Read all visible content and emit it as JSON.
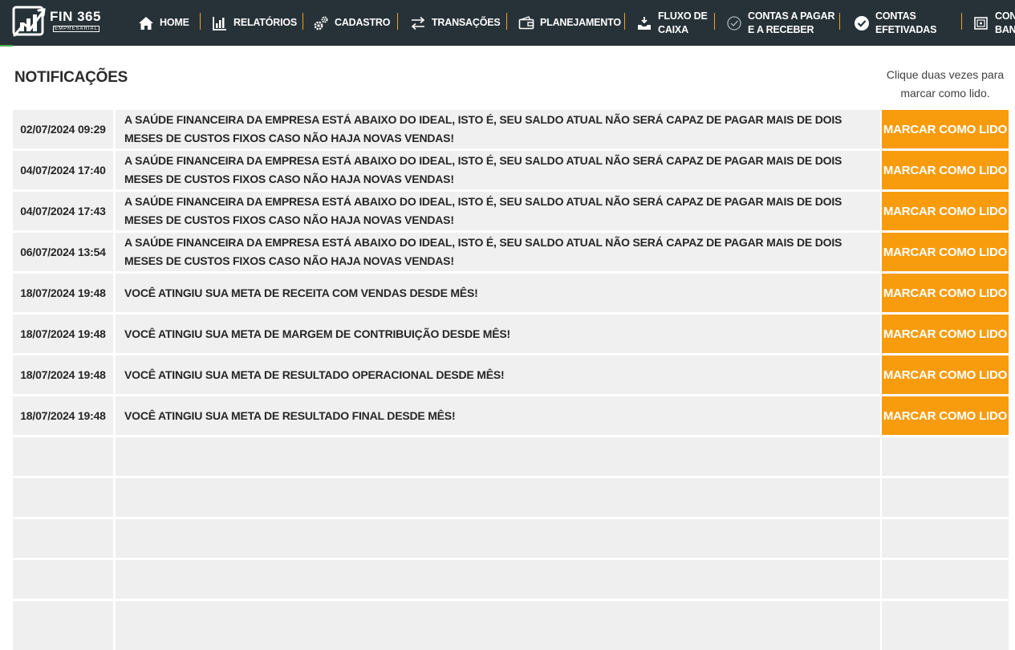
{
  "app": {
    "brand": "FIN 365",
    "brand_sub": "EMPRESARIAL"
  },
  "nav": [
    {
      "label": "HOME",
      "icon": "home-icon"
    },
    {
      "label": "RELATÓRIOS",
      "icon": "bar-chart-icon"
    },
    {
      "label": "CADASTRO",
      "icon": "gears-icon"
    },
    {
      "label": "TRANSAÇÕES",
      "icon": "transfer-arrows-icon"
    },
    {
      "label": "PLANEJAMENTO",
      "icon": "wallet-icon"
    },
    {
      "label": "FLUXO DE\nCAIXA",
      "icon": "money-hand-icon"
    },
    {
      "label": "CONTAS A PAGAR\nE A RECEBER",
      "icon": "check-circle-outline-icon"
    },
    {
      "label": "CONTAS\nEFETIVADAS",
      "icon": "check-circle-filled-icon"
    },
    {
      "label": "CONC\nBANC",
      "icon": "bank-icon"
    }
  ],
  "page": {
    "title": "NOTIFICAÇÕES",
    "hint": "Clique duas vezes para\nmarcar como lido."
  },
  "notifications": [
    {
      "date": "02/07/2024 09:29",
      "message": "A SAÚDE FINANCEIRA DA EMPRESA ESTÁ ABAIXO DO IDEAL, ISTO É, SEU SALDO ATUAL NÃO SERÁ CAPAZ DE PAGAR MAIS DE DOIS MESES DE CUSTOS FIXOS CASO NÃO HAJA NOVAS VENDAS!",
      "action": "MARCAR COMO LIDO"
    },
    {
      "date": "04/07/2024 17:40",
      "message": "A SAÚDE FINANCEIRA DA EMPRESA ESTÁ ABAIXO DO IDEAL, ISTO É, SEU SALDO ATUAL NÃO SERÁ CAPAZ DE PAGAR MAIS DE DOIS MESES DE CUSTOS FIXOS CASO NÃO HAJA NOVAS VENDAS!",
      "action": "MARCAR COMO LIDO"
    },
    {
      "date": "04/07/2024 17:43",
      "message": "A SAÚDE FINANCEIRA DA EMPRESA ESTÁ ABAIXO DO IDEAL, ISTO É, SEU SALDO ATUAL NÃO SERÁ CAPAZ DE PAGAR MAIS DE DOIS MESES DE CUSTOS FIXOS CASO NÃO HAJA NOVAS VENDAS!",
      "action": "MARCAR COMO LIDO"
    },
    {
      "date": "06/07/2024 13:54",
      "message": "A SAÚDE FINANCEIRA DA EMPRESA ESTÁ ABAIXO DO IDEAL, ISTO É, SEU SALDO ATUAL NÃO SERÁ CAPAZ DE PAGAR MAIS DE DOIS MESES DE CUSTOS FIXOS CASO NÃO HAJA NOVAS VENDAS!",
      "action": "MARCAR COMO LIDO"
    },
    {
      "date": "18/07/2024 19:48",
      "message": "VOCÊ ATINGIU SUA META DE RECEITA COM VENDAS DESDE MÊS!",
      "action": "MARCAR COMO LIDO"
    },
    {
      "date": "18/07/2024 19:48",
      "message": "VOCÊ ATINGIU SUA META DE MARGEM DE CONTRIBUIÇÃO DESDE MÊS!",
      "action": "MARCAR COMO LIDO"
    },
    {
      "date": "18/07/2024 19:48",
      "message": "VOCÊ ATINGIU SUA META DE RESULTADO OPERACIONAL DESDE MÊS!",
      "action": "MARCAR COMO LIDO"
    },
    {
      "date": "18/07/2024 19:48",
      "message": "VOCÊ ATINGIU SUA META DE RESULTADO FINAL DESDE MÊS!",
      "action": "MARCAR COMO LIDO"
    }
  ],
  "colors": {
    "topbar": "#273238",
    "accent": "#f89c0e",
    "separator": "#f0a020",
    "row_bg": "#f0f0f0"
  }
}
